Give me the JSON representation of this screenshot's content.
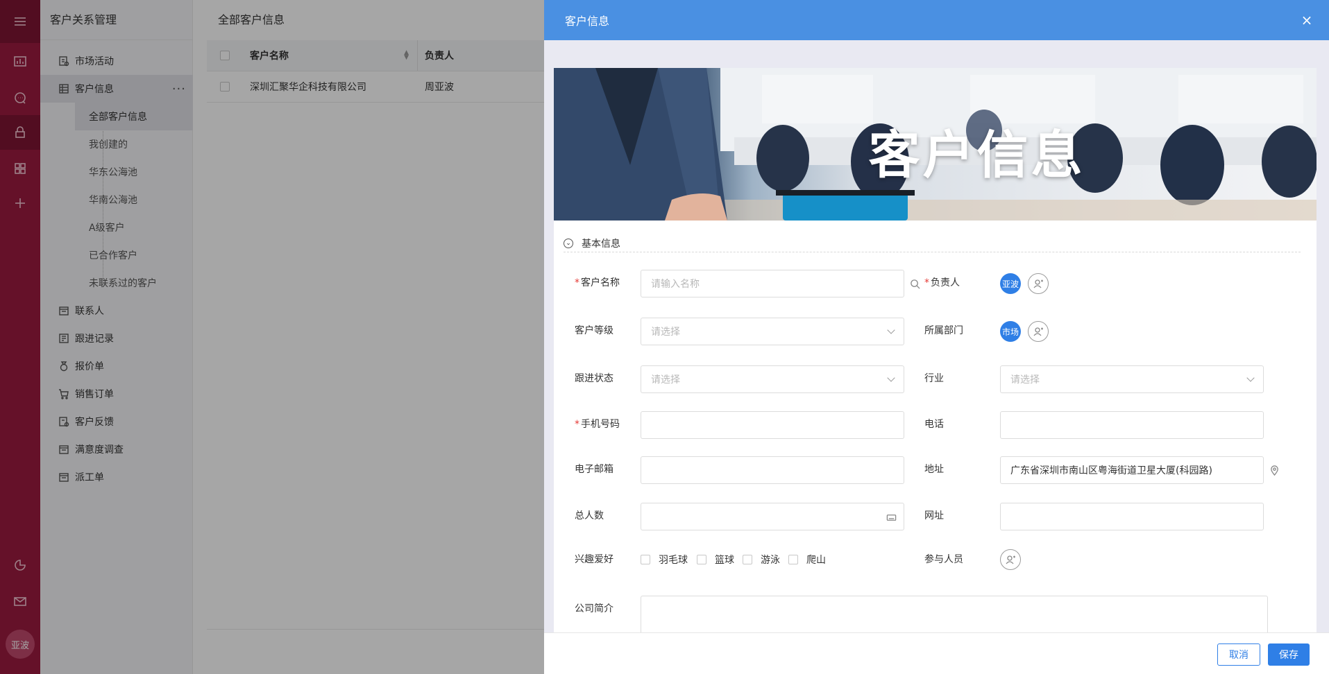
{
  "nav": {
    "title": "客户关系管理",
    "items": [
      {
        "label": "市场活动",
        "icon": "chart-doc-icon"
      },
      {
        "label": "客户信息",
        "icon": "grid-table-icon"
      },
      {
        "label": "联系人",
        "icon": "contacts-icon"
      },
      {
        "label": "跟进记录",
        "icon": "record-icon"
      },
      {
        "label": "报价单",
        "icon": "money-bag-icon"
      },
      {
        "label": "销售订单",
        "icon": "cart-icon"
      },
      {
        "label": "客户反馈",
        "icon": "feedback-icon"
      },
      {
        "label": "满意度调查",
        "icon": "survey-icon"
      },
      {
        "label": "派工单",
        "icon": "dispatch-icon"
      }
    ],
    "more": "···",
    "subitems": [
      "全部客户信息",
      "我创建的",
      "华东公海池",
      "华南公海池",
      "A级客户",
      "已合作客户",
      "未联系过的客户"
    ]
  },
  "rail": {
    "avatar": "亚波"
  },
  "list": {
    "title": "全部客户信息",
    "columns": [
      "客户名称",
      "负责人"
    ],
    "rows": [
      {
        "name": "深圳汇聚华企科技有限公司",
        "owner": "周亚波"
      }
    ]
  },
  "drawer": {
    "title": "客户信息",
    "close": "×",
    "banner_title": "客户信息",
    "section": "基本信息",
    "labels": {
      "customer_name": "客户名称",
      "owner": "负责人",
      "level": "客户等级",
      "department": "所属部门",
      "follow_status": "跟进状态",
      "industry": "行业",
      "mobile": "手机号码",
      "phone": "电话",
      "email": "电子邮箱",
      "address": "地址",
      "headcount": "总人数",
      "website": "网址",
      "hobbies": "兴趣爱好",
      "participants": "参与人员",
      "intro": "公司简介"
    },
    "required_mark": "*",
    "placeholders": {
      "customer_name": "请输入名称",
      "select": "请选择"
    },
    "values": {
      "address": "广东省深圳市南山区粤海街道卫星大厦(科园路)",
      "owner_chip": "亚波",
      "department_chip": "市场"
    },
    "hobby_options": [
      "羽毛球",
      "篮球",
      "游泳",
      "爬山"
    ],
    "buttons": {
      "cancel": "取消",
      "save": "保存"
    }
  },
  "colors": {
    "rail": "#9b1b40",
    "header": "#4a90e2",
    "primary": "#2f7fe6",
    "required": "#e53935"
  }
}
